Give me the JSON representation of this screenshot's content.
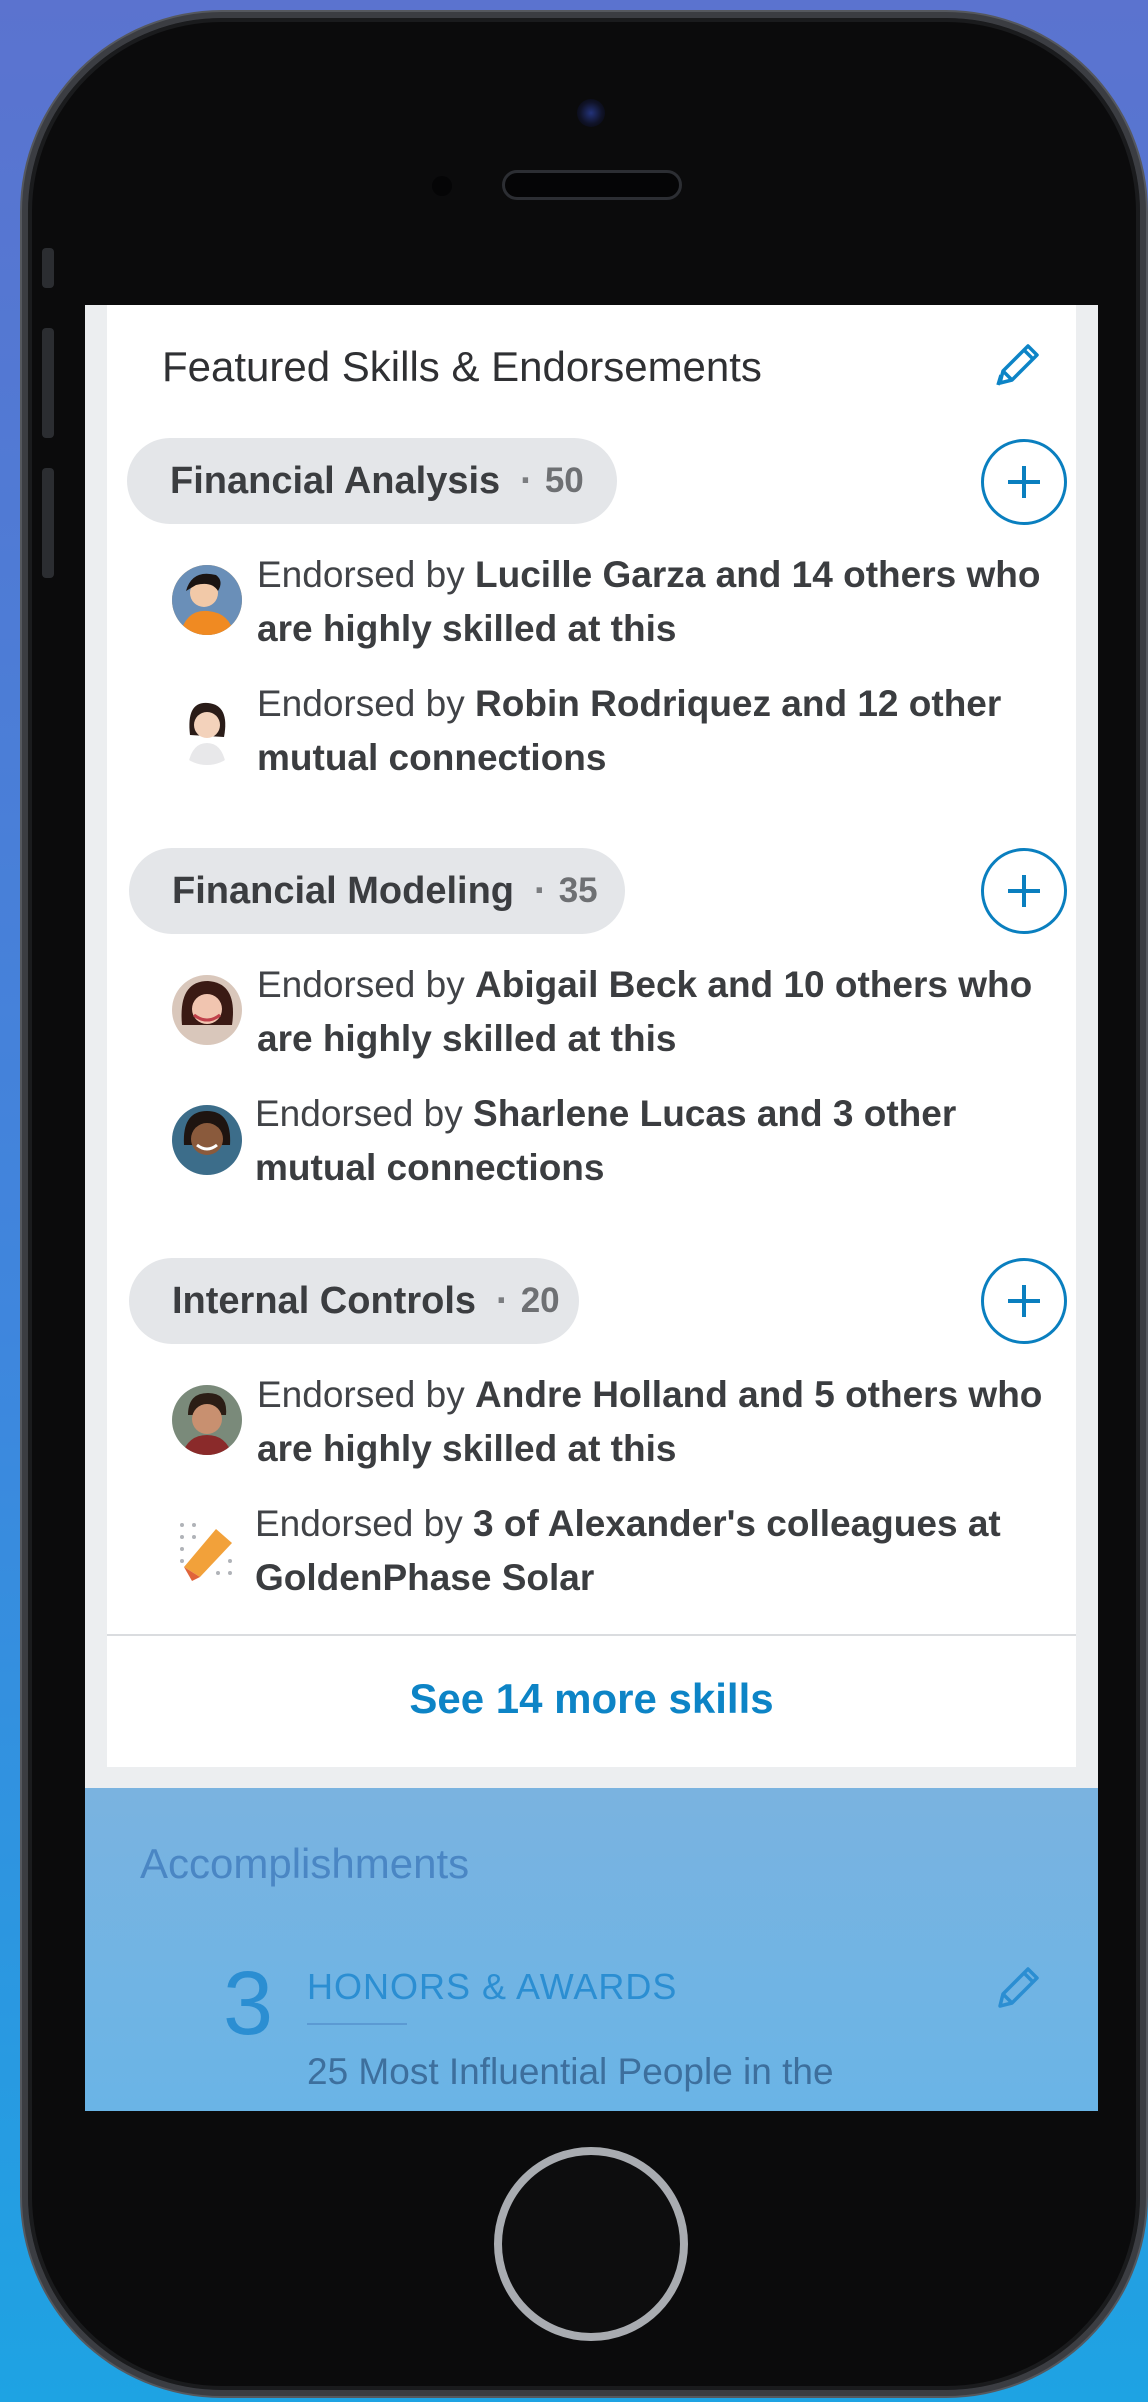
{
  "skills_card": {
    "title": "Featured Skills & Endorsements",
    "skills": [
      {
        "name": "Financial Analysis",
        "separator": "·",
        "count": "50",
        "endorsements": [
          {
            "prefix": "Endorsed by ",
            "bold": "Lucille Garza and 14 others who are highly skilled at this"
          },
          {
            "prefix": "Endorsed by ",
            "bold": "Robin Rodriquez and 12 other mutual connections"
          }
        ]
      },
      {
        "name": "Financial Modeling",
        "separator": "·",
        "count": "35",
        "endorsements": [
          {
            "prefix": "Endorsed by ",
            "bold": "Abigail Beck and 10 others who are highly skilled at this"
          },
          {
            "prefix": "Endorsed by ",
            "bold": "Sharlene Lucas and 3 other mutual connections"
          }
        ]
      },
      {
        "name": "Internal Controls",
        "separator": "·",
        "count": "20",
        "endorsements": [
          {
            "prefix": "Endorsed by ",
            "bold": "Andre Holland and 5 others who are highly skilled at this"
          },
          {
            "prefix": "Endorsed by ",
            "bold": "3 of Alexander's colleagues at GoldenPhase Solar"
          }
        ]
      }
    ],
    "see_more": "See 14 more skills"
  },
  "accomplishments": {
    "title": "Accomplishments",
    "count": "3",
    "category": "HONORS & AWARDS",
    "first_item": "25 Most Influential People in the"
  },
  "colors": {
    "accent": "#0d84c6",
    "pill": "#e4e6e9",
    "accomplishments_bg": "#6ab4e6"
  }
}
